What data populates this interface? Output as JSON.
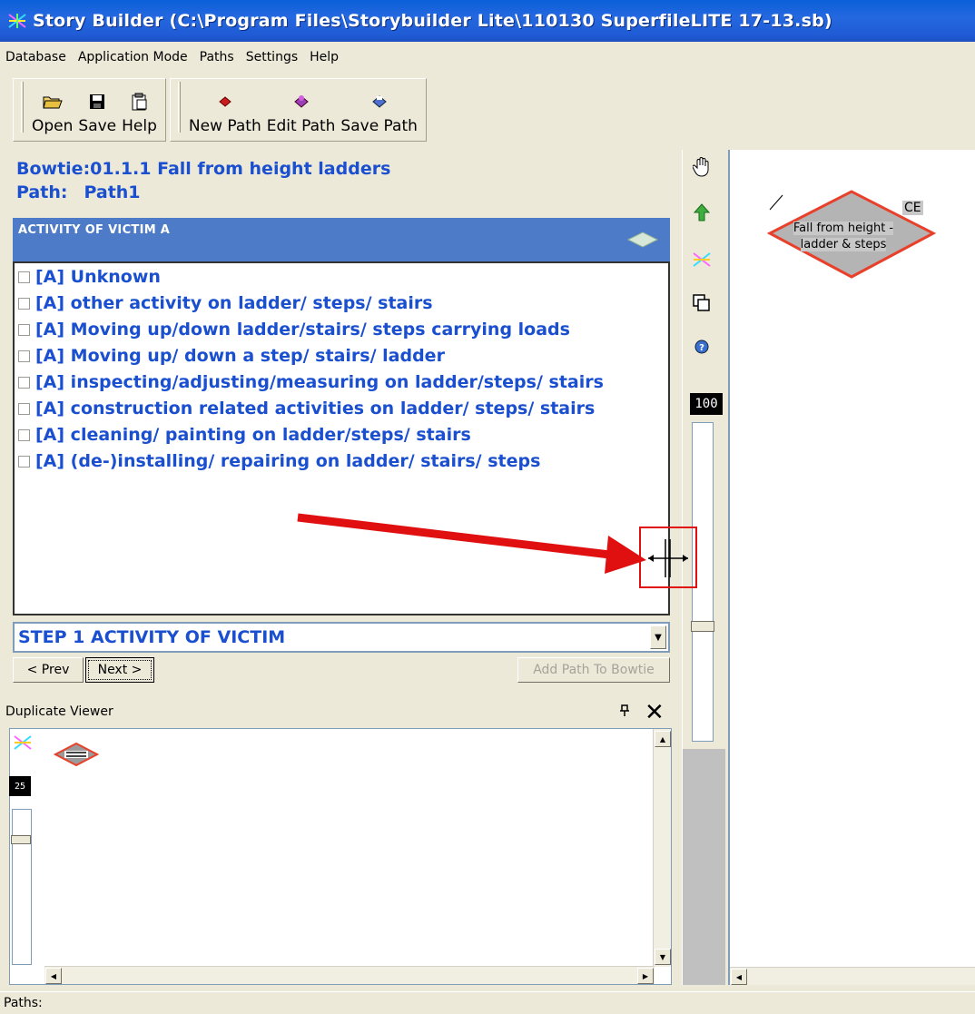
{
  "window": {
    "title": "Story Builder (C:\\Program Files\\Storybuilder Lite\\110130 SuperfileLITE 17-13.sb)"
  },
  "menu": {
    "items": [
      "Database",
      "Application Mode",
      "Paths",
      "Settings",
      "Help"
    ]
  },
  "toolbar": {
    "group1": [
      {
        "label": "Open",
        "icon": "open-folder-icon"
      },
      {
        "label": "Save",
        "icon": "floppy-disk-icon"
      },
      {
        "label": "Help",
        "icon": "clipboard-icon"
      }
    ],
    "group2": [
      {
        "label": "New Path",
        "icon": "red-book-icon"
      },
      {
        "label": "Edit Path",
        "icon": "purple-book-icon"
      },
      {
        "label": "Save Path",
        "icon": "blue-book-icon"
      }
    ]
  },
  "bowtie": {
    "line": "Bowtie:01.1.1 Fall from height ladders",
    "path_label": "Path:",
    "path_value": "Path1"
  },
  "activity": {
    "header": "ACTIVITY OF VICTIM A",
    "items": [
      "[A] Unknown",
      "[A] other activity on ladder/ steps/ stairs",
      "[A] Moving up/down ladder/stairs/ steps carrying loads",
      "[A] Moving up/ down a step/ stairs/ ladder",
      "[A] inspecting/adjusting/measuring on ladder/steps/ stairs",
      "[A] construction related activities on ladder/ steps/ stairs",
      "[A] cleaning/ painting on ladder/steps/ stairs",
      "[A] (de-)installing/ repairing on ladder/ stairs/ steps"
    ]
  },
  "step": {
    "selected": "STEP 1 ACTIVITY OF VICTIM",
    "prev": "< Prev",
    "next": "Next >",
    "add_path": "Add Path To Bowtie"
  },
  "duplicate_viewer": {
    "title": "Duplicate Viewer",
    "zoom": "25"
  },
  "canvas": {
    "zoom": "100",
    "node_text_line1": "Fall from height -",
    "node_text_line2": "ladder & steps",
    "node_tag": "CE"
  },
  "status": {
    "text": "Paths:"
  },
  "colors": {
    "title_blue": "#1f5bd4",
    "item_blue": "#1a4fd0",
    "header_blue": "#4d7bc7",
    "annotation_red": "#e01010",
    "node_gray": "#c8c8c8",
    "node_border": "#e8402a"
  }
}
